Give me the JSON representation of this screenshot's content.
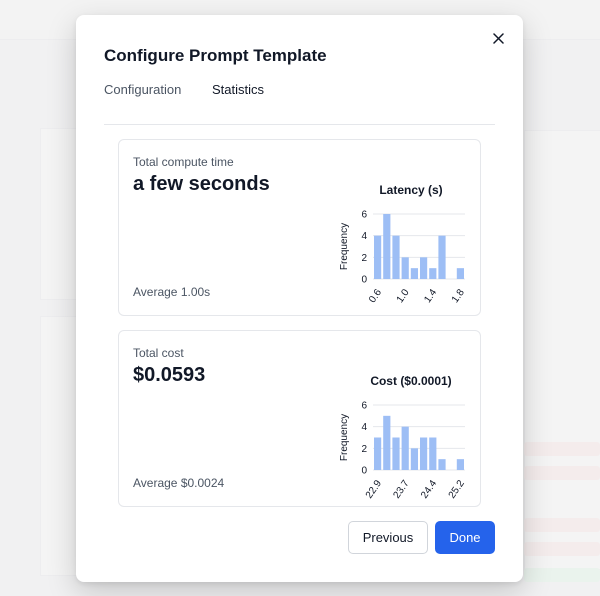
{
  "modal": {
    "title": "Configure Prompt Template",
    "tabs": [
      {
        "label": "Configuration",
        "active": false
      },
      {
        "label": "Statistics",
        "active": true
      }
    ]
  },
  "stats": {
    "time": {
      "label": "Total compute time",
      "value": "a few seconds",
      "average": "Average 1.00s"
    },
    "cost": {
      "label": "Total cost",
      "value": "$0.0593",
      "average": "Average $0.0024"
    }
  },
  "buttons": {
    "previous": "Previous",
    "done": "Done"
  },
  "colors": {
    "accent": "#2563eb",
    "bar": "#9dbef5"
  },
  "chart_data": [
    {
      "type": "bar",
      "title": "Latency (s)",
      "ylabel": "Frequency",
      "xlabel": "",
      "ylim": [
        0,
        6
      ],
      "yticks": [
        0,
        2,
        4,
        6
      ],
      "tick_labels": [
        "0.6",
        "1.0",
        "1.4",
        "1.8"
      ],
      "values": [
        4,
        6,
        4,
        2,
        1,
        2,
        1,
        4,
        0,
        1
      ],
      "grid": true
    },
    {
      "type": "bar",
      "title": "Cost ($0.0001)",
      "ylabel": "Frequency",
      "xlabel": "",
      "ylim": [
        0,
        6
      ],
      "yticks": [
        0,
        2,
        4,
        6
      ],
      "tick_labels": [
        "22.9",
        "23.7",
        "24.4",
        "25.2"
      ],
      "values": [
        3,
        5,
        3,
        4,
        2,
        3,
        3,
        1,
        0,
        1
      ],
      "grid": true
    }
  ]
}
